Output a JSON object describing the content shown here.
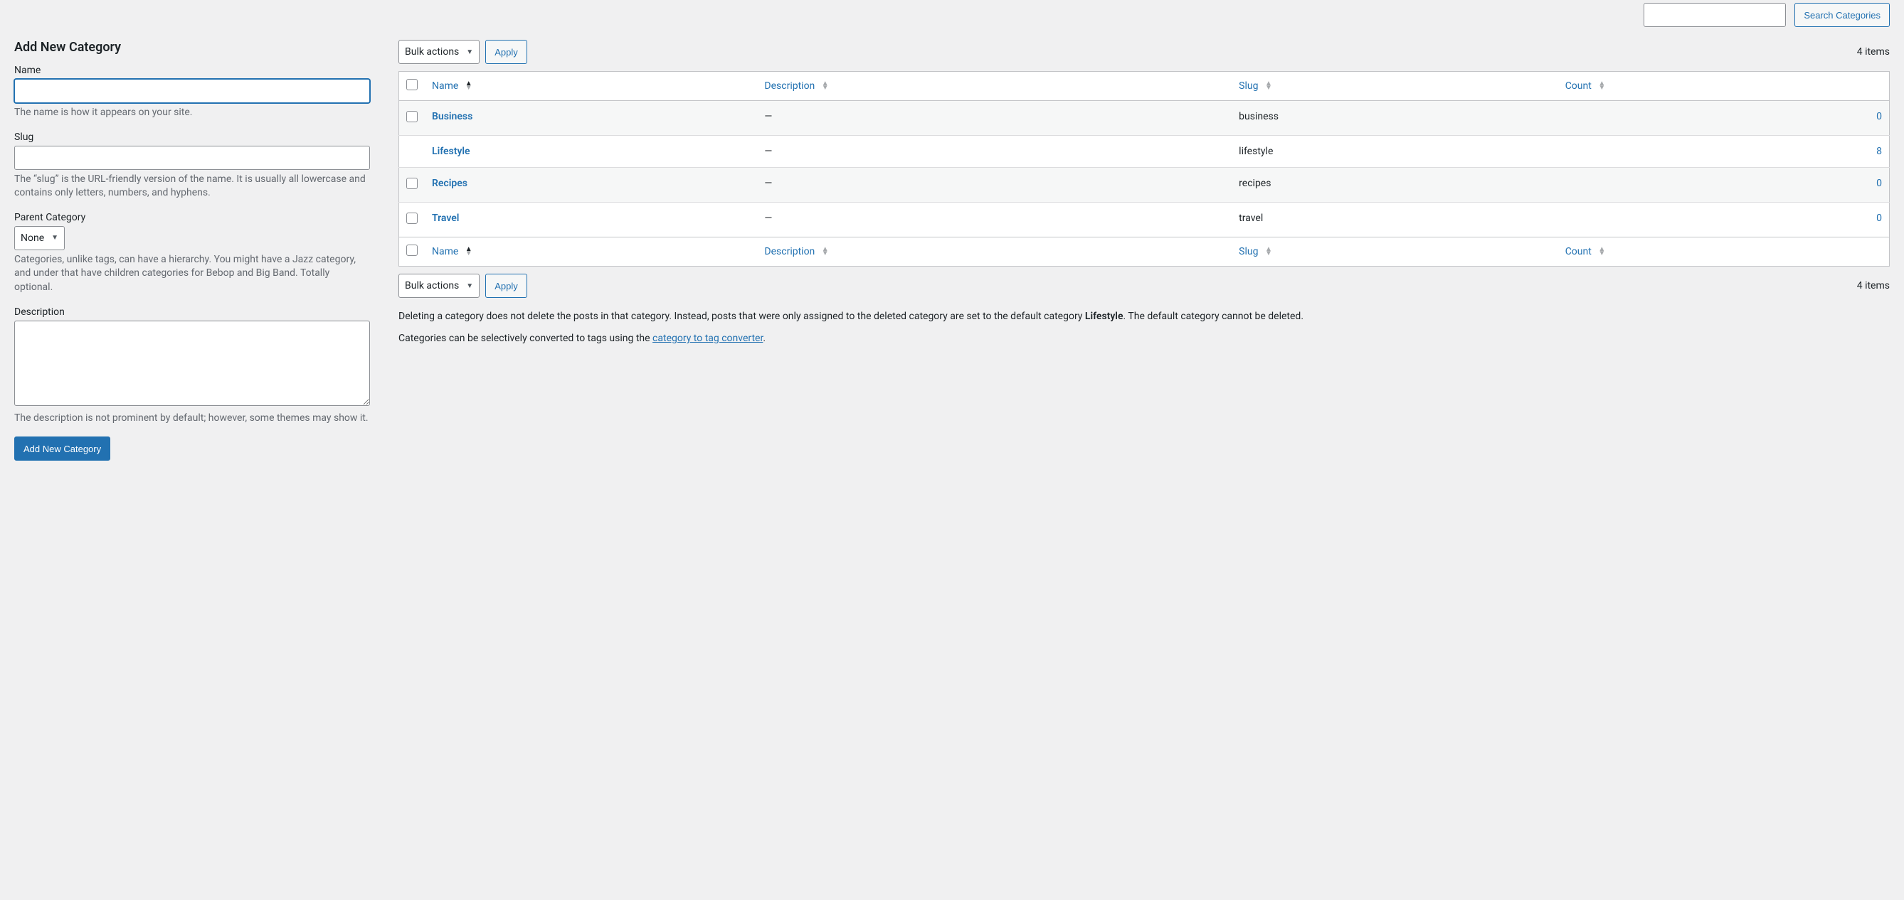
{
  "search": {
    "placeholder": "",
    "button_label": "Search Categories"
  },
  "form": {
    "heading": "Add New Category",
    "name_label": "Name",
    "name_help": "The name is how it appears on your site.",
    "slug_label": "Slug",
    "slug_help": "The “slug” is the URL-friendly version of the name. It is usually all lowercase and contains only letters, numbers, and hyphens.",
    "parent_label": "Parent Category",
    "parent_selected": "None",
    "parent_help": "Categories, unlike tags, can have a hierarchy. You might have a Jazz category, and under that have children categories for Bebop and Big Band. Totally optional.",
    "description_label": "Description",
    "description_help": "The description is not prominent by default; however, some themes may show it.",
    "submit_label": "Add New Category"
  },
  "list": {
    "bulk_label": "Bulk actions",
    "apply_label": "Apply",
    "items_count_text": "4 items",
    "columns": {
      "name": "Name",
      "description": "Description",
      "slug": "Slug",
      "count": "Count"
    },
    "rows": [
      {
        "name": "Business",
        "description": "—",
        "slug": "business",
        "count": "0",
        "checkable": true
      },
      {
        "name": "Lifestyle",
        "description": "—",
        "slug": "lifestyle",
        "count": "8",
        "checkable": false
      },
      {
        "name": "Recipes",
        "description": "—",
        "slug": "recipes",
        "count": "0",
        "checkable": true
      },
      {
        "name": "Travel",
        "description": "—",
        "slug": "travel",
        "count": "0",
        "checkable": true
      }
    ]
  },
  "notes": {
    "delete_prefix": "Deleting a category does not delete the posts in that category. Instead, posts that were only assigned to the deleted category are set to the default category ",
    "default_category": "Lifestyle",
    "delete_suffix": ". The default category cannot be deleted.",
    "convert_prefix": "Categories can be selectively converted to tags using the ",
    "convert_link": "category to tag converter",
    "convert_suffix": "."
  }
}
